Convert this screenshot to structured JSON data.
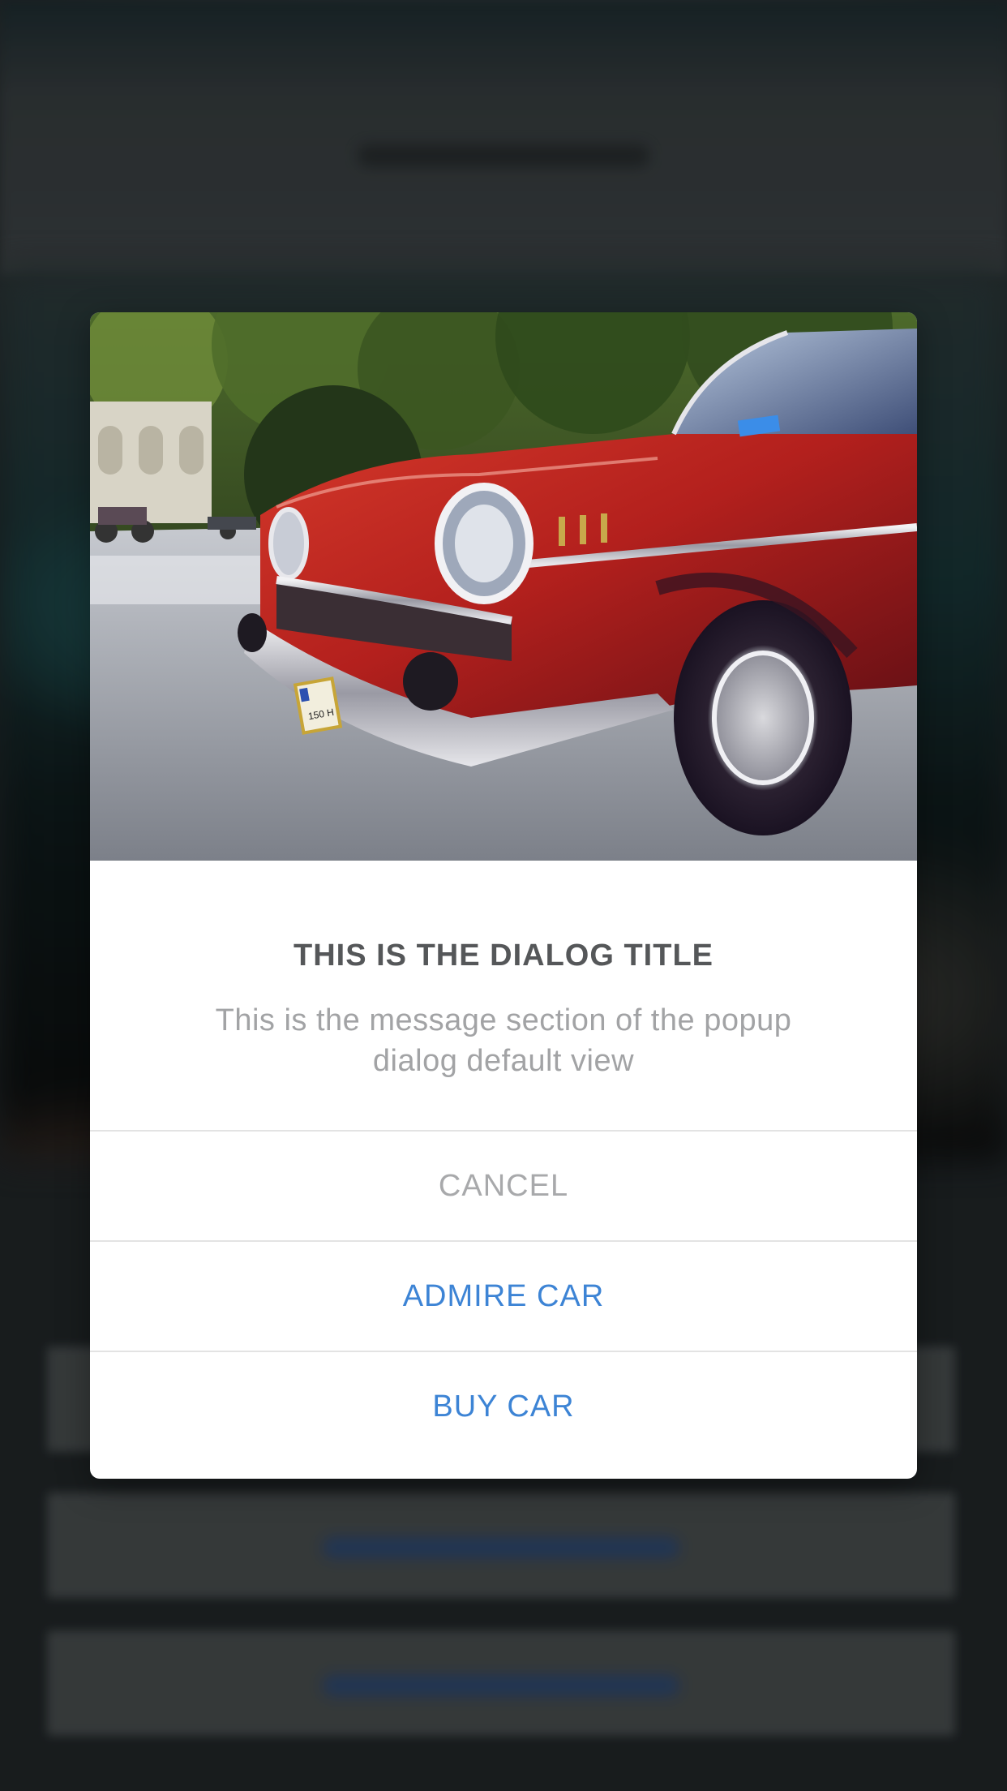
{
  "dialog": {
    "title": "THIS IS THE DIALOG TITLE",
    "message": "This is the message section of the popup dialog default view",
    "image_icon": "red-classic-car-photo",
    "actions": [
      {
        "label": "CANCEL",
        "style": "cancel",
        "color": "#a8a9ab"
      },
      {
        "label": "ADMIRE CAR",
        "style": "primary",
        "color": "#3d84d5"
      },
      {
        "label": "BUY CAR",
        "style": "primary",
        "color": "#3d84d5"
      }
    ]
  },
  "plate": {
    "text": "150 H"
  },
  "colors": {
    "accent": "#3d84d5",
    "title": "#555759",
    "message": "#a2a3a5",
    "divider": "#e3e3e3",
    "car_body": "#c0231f"
  }
}
